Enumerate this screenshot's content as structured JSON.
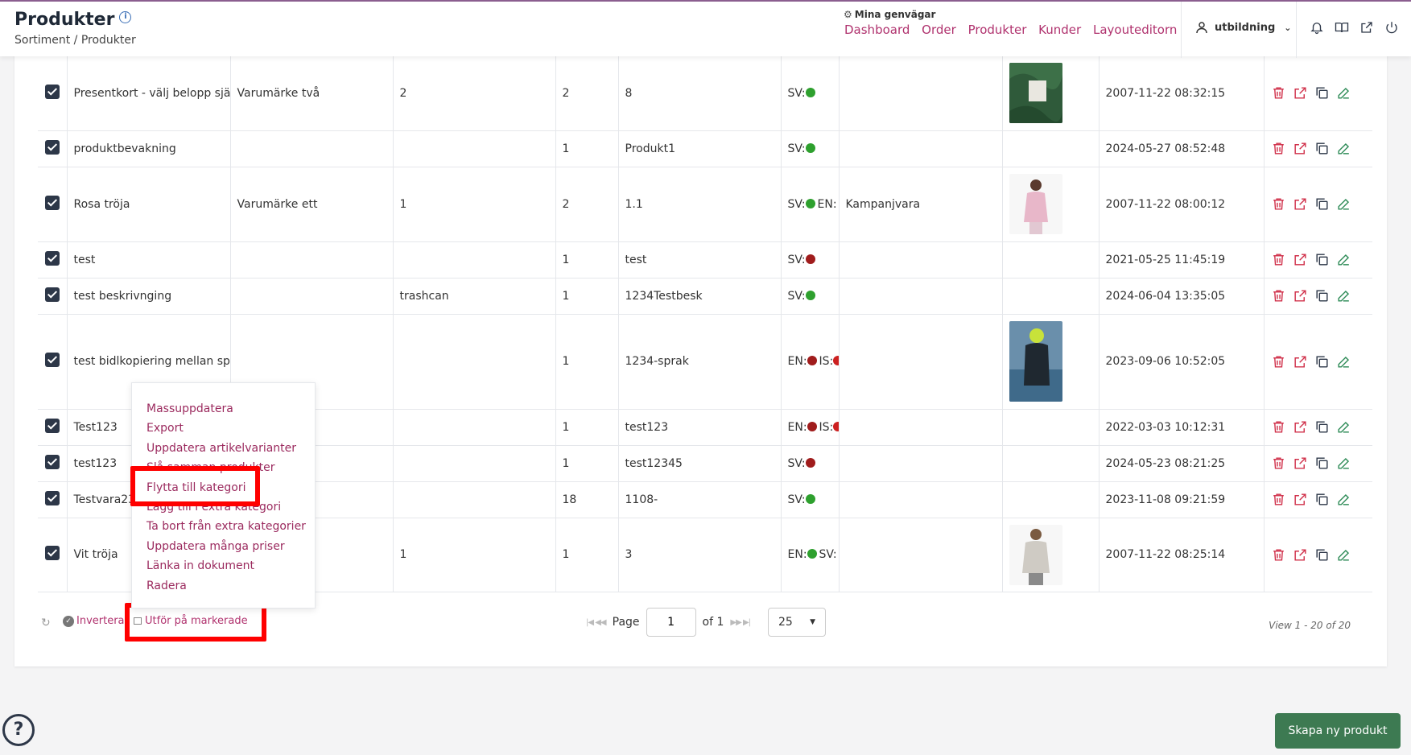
{
  "header": {
    "title": "Produkter",
    "breadcrumb": "Sortiment / Produkter",
    "shortcuts_title": "Mina genvägar",
    "shortcuts": [
      "Dashboard",
      "Order",
      "Produkter",
      "Kunder",
      "Layouteditorn"
    ],
    "user": "utbildning"
  },
  "rows": [
    {
      "name": "Presentkort - välj belopp själv",
      "brand": "Varumärke två",
      "col3": "2",
      "col4": "2",
      "artnr": "8",
      "langs": [
        {
          "code": "SV:",
          "color": "#2ea02e"
        }
      ],
      "campaign": "",
      "image": "giftcard",
      "date": "2007-11-22 08:32:15"
    },
    {
      "name": "produktbevakning",
      "brand": "",
      "col3": "",
      "col4": "1",
      "artnr": "Produkt1",
      "langs": [
        {
          "code": "SV:",
          "color": "#2ea02e"
        }
      ],
      "campaign": "",
      "image": "",
      "date": "2024-05-27 08:52:48"
    },
    {
      "name": "Rosa tröja",
      "brand": "Varumärke ett",
      "col3": "1",
      "col4": "2",
      "artnr": "1.1",
      "langs": [
        {
          "code": "SV:",
          "color": "#2ea02e"
        },
        {
          "code": "EN:",
          "color": ""
        }
      ],
      "campaign": "Kampanjvara",
      "image": "pink",
      "date": "2007-11-22 08:00:12"
    },
    {
      "name": "test",
      "brand": "",
      "col3": "",
      "col4": "1",
      "artnr": "test",
      "langs": [
        {
          "code": "SV:",
          "color": "#a01c1c"
        }
      ],
      "campaign": "",
      "image": "",
      "date": "2021-05-25 11:45:19"
    },
    {
      "name": "test beskrivnging",
      "brand": "",
      "col3": "trashcan",
      "col4": "1",
      "artnr": "1234Testbesk",
      "langs": [
        {
          "code": "SV:",
          "color": "#2ea02e"
        }
      ],
      "campaign": "",
      "image": "",
      "date": "2024-06-04 13:35:05"
    },
    {
      "name": "test bidlkopiering mellan språk",
      "brand": "",
      "col3": "",
      "col4": "1",
      "artnr": "1234-sprak",
      "langs": [
        {
          "code": "EN:",
          "color": "#a01c1c"
        },
        {
          "code": "IS:",
          "color": "#cc2020"
        }
      ],
      "campaign": "",
      "image": "swimmer",
      "date": "2023-09-06 10:52:05"
    },
    {
      "name": "Test123",
      "brand": "",
      "col3": "",
      "col4": "1",
      "artnr": "test123",
      "langs": [
        {
          "code": "EN:",
          "color": "#a01c1c"
        },
        {
          "code": "IS:",
          "color": "#cc2020"
        }
      ],
      "campaign": "",
      "image": "",
      "date": "2022-03-03 10:12:31"
    },
    {
      "name": "test123",
      "brand": "",
      "col3": "",
      "col4": "1",
      "artnr": "test12345",
      "langs": [
        {
          "code": "SV:",
          "color": "#a01c1c"
        }
      ],
      "campaign": "",
      "image": "",
      "date": "2024-05-23 08:21:25"
    },
    {
      "name": "Testvara23",
      "brand": "",
      "col3": "",
      "col4": "18",
      "artnr": "1108-",
      "langs": [
        {
          "code": "SV:",
          "color": "#2ea02e"
        }
      ],
      "campaign": "",
      "image": "",
      "date": "2023-11-08 09:21:59"
    },
    {
      "name": "Vit tröja",
      "brand": "",
      "col3": "1",
      "col4": "1",
      "artnr": "3",
      "langs": [
        {
          "code": "EN:",
          "color": "#2ea02e"
        },
        {
          "code": "SV:",
          "color": ""
        }
      ],
      "campaign": "",
      "image": "white",
      "date": "2007-11-22 08:25:14"
    }
  ],
  "menu": {
    "items": [
      "Massuppdatera",
      "Export",
      "Uppdatera artikelvarianter",
      "Slå samman produkter",
      "Flytta till kategori",
      "Lägg till i extra kategori",
      "Ta bort från extra kategorier",
      "Uppdatera många priser",
      "Länka in dokument",
      "Radera"
    ]
  },
  "footer": {
    "invert": "Invertera",
    "perform": "Utför på markerade",
    "page_label": "Page",
    "page_value": "1",
    "of_label": "of 1",
    "per_page": "25",
    "view_info": "View 1 - 20 of 20"
  },
  "create_button": "Skapa ny produkt",
  "colors": {
    "accent": "#b0326e",
    "highlight": "#ff0000",
    "create": "#3d7a52"
  }
}
